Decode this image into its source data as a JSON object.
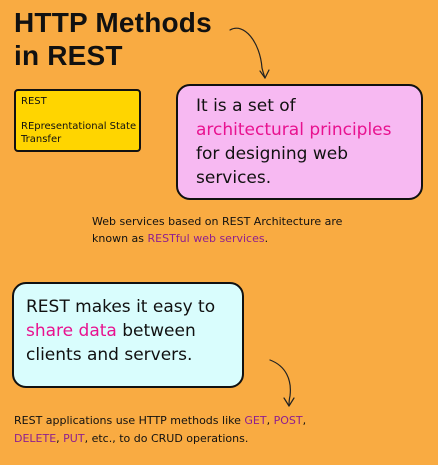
{
  "title": {
    "line1": "HTTP Methods",
    "line2": "in REST"
  },
  "rest_box": {
    "abbr": "REST",
    "expansion": "REpresentational State Transfer"
  },
  "definition_box": {
    "line1": "It is a set of",
    "line2_highlight": "architectural principles",
    "line3": "for designing web",
    "line4": "services."
  },
  "web_services_note": {
    "line1": "Web services based on REST Architecture are",
    "line2_prefix": "known as ",
    "line2_highlight": "RESTful web services",
    "line2_suffix": "."
  },
  "share_box": {
    "line1": "REST makes it easy to",
    "line2_highlight": "share data",
    "line2_suffix": " between",
    "line3": "clients and servers."
  },
  "methods_note": {
    "line1_prefix": "REST applications use HTTP methods like ",
    "get": "GET",
    "comma1": ", ",
    "post": "POST",
    "comma2": ",",
    "delete": "DELETE",
    "comma3": ", ",
    "put": "PUT",
    "line2_suffix": ", etc., to do CRUD operations."
  },
  "colors": {
    "background": "#f9ab42",
    "rest_box": "#ffd500",
    "definition_box": "#f7b9f2",
    "share_box": "#d9fdfd",
    "highlight_pink": "#e8128f",
    "highlight_purple": "#8e1f8f"
  }
}
